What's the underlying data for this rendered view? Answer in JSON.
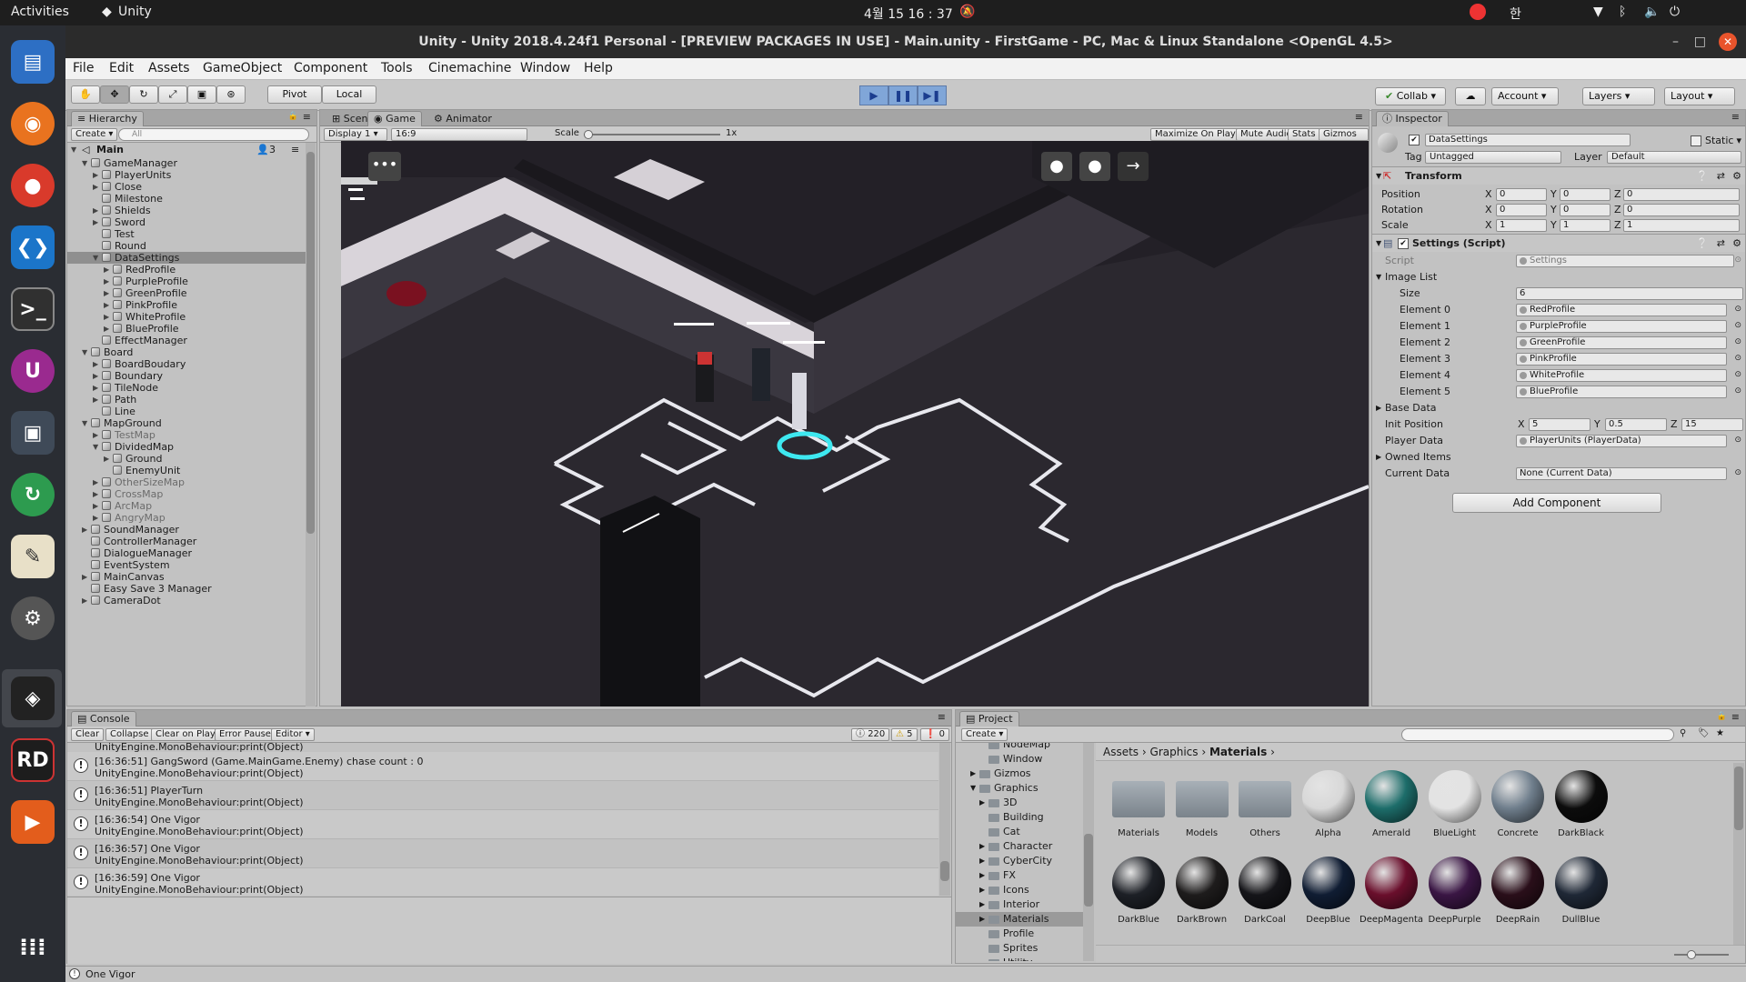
{
  "topbar": {
    "activities": "Activities",
    "app_name": "Unity",
    "clock": "4월 15  16 : 37",
    "ime": "한"
  },
  "window": {
    "title": "Unity - Unity 2018.4.24f1 Personal - [PREVIEW PACKAGES IN USE] - Main.unity - FirstGame - PC, Mac & Linux Standalone <OpenGL 4.5>"
  },
  "menu": [
    "File",
    "Edit",
    "Assets",
    "GameObject",
    "Component",
    "Tools",
    "Cinemachine",
    "Window",
    "Help"
  ],
  "toolbar": {
    "pivot": "Pivot",
    "local": "Local",
    "collab": "Collab",
    "account": "Account",
    "layers": "Layers",
    "layout": "Layout"
  },
  "hierarchy": {
    "tab": "Hierarchy",
    "create": "Create",
    "search_placeholder": "All",
    "scene": "Main",
    "count": "3",
    "rows": [
      {
        "label": "GameManager",
        "depth": 1,
        "arrow": "▼",
        "dim": false
      },
      {
        "label": "PlayerUnits",
        "depth": 2,
        "arrow": "▶",
        "dim": false
      },
      {
        "label": "Close",
        "depth": 2,
        "arrow": "▶",
        "dim": false
      },
      {
        "label": "Milestone",
        "depth": 2,
        "arrow": "",
        "dim": false
      },
      {
        "label": "Shields",
        "depth": 2,
        "arrow": "▶",
        "dim": false
      },
      {
        "label": "Sword",
        "depth": 2,
        "arrow": "▶",
        "dim": false
      },
      {
        "label": "Test",
        "depth": 2,
        "arrow": "",
        "dim": false
      },
      {
        "label": "Round",
        "depth": 2,
        "arrow": "",
        "dim": false
      },
      {
        "label": "DataSettings",
        "depth": 2,
        "arrow": "▼",
        "dim": false,
        "selected": true
      },
      {
        "label": "RedProfile",
        "depth": 3,
        "arrow": "▶",
        "dim": false
      },
      {
        "label": "PurpleProfile",
        "depth": 3,
        "arrow": "▶",
        "dim": false
      },
      {
        "label": "GreenProfile",
        "depth": 3,
        "arrow": "▶",
        "dim": false
      },
      {
        "label": "PinkProfile",
        "depth": 3,
        "arrow": "▶",
        "dim": false
      },
      {
        "label": "WhiteProfile",
        "depth": 3,
        "arrow": "▶",
        "dim": false
      },
      {
        "label": "BlueProfile",
        "depth": 3,
        "arrow": "▶",
        "dim": false
      },
      {
        "label": "EffectManager",
        "depth": 2,
        "arrow": "",
        "dim": false
      },
      {
        "label": "Board",
        "depth": 1,
        "arrow": "▼",
        "dim": false
      },
      {
        "label": "BoardBoudary",
        "depth": 2,
        "arrow": "▶",
        "dim": false
      },
      {
        "label": "Boundary",
        "depth": 2,
        "arrow": "▶",
        "dim": false
      },
      {
        "label": "TileNode",
        "depth": 2,
        "arrow": "▶",
        "dim": false
      },
      {
        "label": "Path",
        "depth": 2,
        "arrow": "▶",
        "dim": false
      },
      {
        "label": "Line",
        "depth": 2,
        "arrow": "",
        "dim": false
      },
      {
        "label": "MapGround",
        "depth": 1,
        "arrow": "▼",
        "dim": false
      },
      {
        "label": "TestMap",
        "depth": 2,
        "arrow": "▶",
        "dim": true
      },
      {
        "label": "DividedMap",
        "depth": 2,
        "arrow": "▼",
        "dim": false
      },
      {
        "label": "Ground",
        "depth": 3,
        "arrow": "▶",
        "dim": false
      },
      {
        "label": "EnemyUnit",
        "depth": 3,
        "arrow": "",
        "dim": false
      },
      {
        "label": "OtherSizeMap",
        "depth": 2,
        "arrow": "▶",
        "dim": true
      },
      {
        "label": "CrossMap",
        "depth": 2,
        "arrow": "▶",
        "dim": true
      },
      {
        "label": "ArcMap",
        "depth": 2,
        "arrow": "▶",
        "dim": true
      },
      {
        "label": "AngryMap",
        "depth": 2,
        "arrow": "▶",
        "dim": true
      },
      {
        "label": "SoundManager",
        "depth": 1,
        "arrow": "▶",
        "dim": false
      },
      {
        "label": "ControllerManager",
        "depth": 1,
        "arrow": "",
        "dim": false
      },
      {
        "label": "DialogueManager",
        "depth": 1,
        "arrow": "",
        "dim": false
      },
      {
        "label": "EventSystem",
        "depth": 1,
        "arrow": "",
        "dim": false
      },
      {
        "label": "MainCanvas",
        "depth": 1,
        "arrow": "▶",
        "dim": false
      },
      {
        "label": "Easy Save 3 Manager",
        "depth": 1,
        "arrow": "",
        "dim": false
      },
      {
        "label": "CameraDot",
        "depth": 1,
        "arrow": "▶",
        "dim": false
      }
    ]
  },
  "views": {
    "tabs": [
      "Scene",
      "Game",
      "Animator"
    ],
    "display": "Display 1",
    "aspect": "16:9",
    "scale_label": "Scale",
    "scale_value": "1x",
    "maximize": "Maximize On Play",
    "mute": "Mute Audio",
    "stats": "Stats",
    "gizmos": "Gizmos"
  },
  "inspector": {
    "tab": "Inspector",
    "object_name": "DataSettings",
    "static": "Static",
    "tag_label": "Tag",
    "tag": "Untagged",
    "layer_label": "Layer",
    "layer": "Default",
    "transform": "Transform",
    "rows": [
      {
        "label": "Position",
        "x": "0",
        "y": "0",
        "z": "0"
      },
      {
        "label": "Rotation",
        "x": "0",
        "y": "0",
        "z": "0"
      },
      {
        "label": "Scale",
        "x": "1",
        "y": "1",
        "z": "1"
      }
    ],
    "script_component": "Settings (Script)",
    "script_label": "Script",
    "script_value": "Settings",
    "image_list": "Image List",
    "size_label": "Size",
    "size": "6",
    "elements": [
      {
        "label": "Element 0",
        "value": "RedProfile"
      },
      {
        "label": "Element 1",
        "value": "PurpleProfile"
      },
      {
        "label": "Element 2",
        "value": "GreenProfile"
      },
      {
        "label": "Element 3",
        "value": "PinkProfile"
      },
      {
        "label": "Element 4",
        "value": "WhiteProfile"
      },
      {
        "label": "Element 5",
        "value": "BlueProfile"
      }
    ],
    "base_data": "Base Data",
    "init_label": "Init Position",
    "init_x": "5",
    "init_y": "0.5",
    "init_z": "15",
    "player_label": "Player Data",
    "player_value": "PlayerUnits (PlayerData)",
    "owned": "Owned Items",
    "current_label": "Current Data",
    "current_value": "None (Current Data)",
    "add_component": "Add Component"
  },
  "console": {
    "tab": "Console",
    "buttons": [
      "Clear",
      "Collapse",
      "Clear on Play",
      "Error Pause",
      "Editor"
    ],
    "info_count": "220",
    "warn_count": "5",
    "err_count": "0",
    "cut_line": "UnityEngine.MonoBehaviour:print(Object)",
    "logs": [
      {
        "line1": "[16:36:51] GangSword (Game.MainGame.Enemy) chase count : 0",
        "line2": "UnityEngine.MonoBehaviour:print(Object)"
      },
      {
        "line1": "[16:36:51] PlayerTurn",
        "line2": "UnityEngine.MonoBehaviour:print(Object)"
      },
      {
        "line1": "[16:36:54] One Vigor",
        "line2": "UnityEngine.MonoBehaviour:print(Object)"
      },
      {
        "line1": "[16:36:57] One Vigor",
        "line2": "UnityEngine.MonoBehaviour:print(Object)"
      },
      {
        "line1": "[16:36:59] One Vigor",
        "line2": "UnityEngine.MonoBehaviour:print(Object)"
      }
    ]
  },
  "project": {
    "tab": "Project",
    "create": "Create",
    "breadcrumb": [
      "Assets",
      "Graphics",
      "Materials"
    ],
    "tree": [
      {
        "label": "NodeMap",
        "depth": 2,
        "arrow": ""
      },
      {
        "label": "Window",
        "depth": 2,
        "arrow": ""
      },
      {
        "label": "Gizmos",
        "depth": 1,
        "arrow": "▶"
      },
      {
        "label": "Graphics",
        "depth": 1,
        "arrow": "▼"
      },
      {
        "label": "3D",
        "depth": 2,
        "arrow": "▶"
      },
      {
        "label": "Building",
        "depth": 2,
        "arrow": ""
      },
      {
        "label": "Cat",
        "depth": 2,
        "arrow": ""
      },
      {
        "label": "Character",
        "depth": 2,
        "arrow": "▶"
      },
      {
        "label": "CyberCity",
        "depth": 2,
        "arrow": "▶"
      },
      {
        "label": "FX",
        "depth": 2,
        "arrow": "▶"
      },
      {
        "label": "Icons",
        "depth": 2,
        "arrow": "▶"
      },
      {
        "label": "Interior",
        "depth": 2,
        "arrow": "▶"
      },
      {
        "label": "Materials",
        "depth": 2,
        "arrow": "▶",
        "selected": true
      },
      {
        "label": "Profile",
        "depth": 2,
        "arrow": ""
      },
      {
        "label": "Sprites",
        "depth": 2,
        "arrow": ""
      },
      {
        "label": "Utility",
        "depth": 2,
        "arrow": ""
      }
    ],
    "assets": [
      {
        "name": "Materials",
        "kind": "folder",
        "color": "#8b939a"
      },
      {
        "name": "Models",
        "kind": "folder",
        "color": "#8b939a"
      },
      {
        "name": "Others",
        "kind": "folder",
        "color": "#8b939a"
      },
      {
        "name": "Alpha",
        "kind": "ball",
        "color": "#d8d8d8"
      },
      {
        "name": "Amerald",
        "kind": "ball",
        "color": "#1d6d6a"
      },
      {
        "name": "BlueLight",
        "kind": "ball",
        "color": "#e3e3e3"
      },
      {
        "name": "Concrete",
        "kind": "ball",
        "color": "#6f7e8c"
      },
      {
        "name": "DarkBlack",
        "kind": "ball",
        "color": "#0c0c0c"
      },
      {
        "name": "DarkBlue",
        "kind": "ball",
        "color": "#1d2026"
      },
      {
        "name": "DarkBrown",
        "kind": "ball",
        "color": "#1e1c1c"
      },
      {
        "name": "DarkCoal",
        "kind": "ball",
        "color": "#151519"
      },
      {
        "name": "DeepBlue",
        "kind": "ball",
        "color": "#101d33"
      },
      {
        "name": "DeepMagenta",
        "kind": "ball",
        "color": "#6a0f2c"
      },
      {
        "name": "DeepPurple",
        "kind": "ball",
        "color": "#3a1644"
      },
      {
        "name": "DeepRain",
        "kind": "ball",
        "color": "#2a0f1a"
      },
      {
        "name": "DullBlue",
        "kind": "ball",
        "color": "#1f2836"
      }
    ]
  },
  "status": {
    "text": "One Vigor"
  }
}
